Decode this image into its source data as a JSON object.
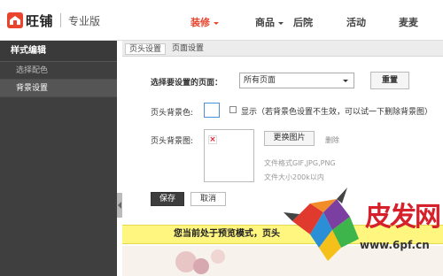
{
  "header": {
    "logo_text": "旺铺",
    "logo_subtitle": "专业版",
    "nav": [
      {
        "label": "装修",
        "active": true,
        "dropdown": true
      },
      {
        "label": "商品",
        "active": false,
        "dropdown": true
      },
      {
        "label": "后院",
        "active": false,
        "dropdown": false
      },
      {
        "label": "活动",
        "active": false,
        "dropdown": false
      },
      {
        "label": "麦麦",
        "active": false,
        "dropdown": false
      }
    ],
    "accent_color": "#e8442e"
  },
  "sidebar": {
    "title": "样式编辑",
    "items": [
      {
        "label": "选择配色",
        "active": false
      },
      {
        "label": "背景设置",
        "active": true
      }
    ]
  },
  "tabs": [
    {
      "label": "页头设置",
      "active": true
    },
    {
      "label": "页面设置",
      "active": false
    }
  ],
  "form": {
    "page_select_label": "选择要设置的页面：",
    "page_select_value": "所有页面",
    "reset_label": "重置",
    "bg_color_label": "页头背景色:",
    "show_label": "显示（若背景色设置不生效，可以试一下删除背景图）",
    "bg_image_label": "页头背景图:",
    "change_image_label": "更换图片",
    "delete_label": "删除",
    "hint_format": "文件格式GIF,JPG,PNG",
    "hint_size": "文件大小200k以内",
    "save_label": "保存",
    "cancel_label": "取消"
  },
  "notice": "您当前处于预览模式，页头",
  "watermark": {
    "text": "皮发网",
    "url": "www.6pf.cn"
  },
  "icons": {
    "logo": "house-icon",
    "broken_image": "broken-image-icon"
  }
}
